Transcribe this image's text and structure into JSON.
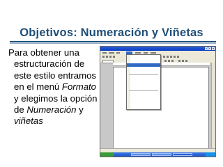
{
  "slide": {
    "title": "Objetivos: Numeración y Viñetas",
    "body": {
      "l1": "Para obtener una",
      "l2": "estructuración de",
      "l3": "este estilo entramos",
      "l4a": "en el menú ",
      "l4b": "Formato",
      "l5": "y elegimos la opción",
      "l6a": "de ",
      "l6b": "Numeración",
      "l6c": " y",
      "l7": "viñetas"
    }
  },
  "screenshot": {
    "colors": {
      "titlebar": "#0a3cc2",
      "menu_highlight": "#316ac5",
      "taskbar": "#1f55c9",
      "start": "#3a9b3a"
    }
  }
}
